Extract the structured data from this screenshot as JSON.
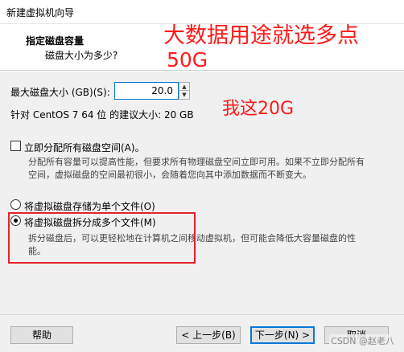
{
  "window": {
    "title": "新建虚拟机向导"
  },
  "header": {
    "title": "指定磁盘容量",
    "subtitle": "磁盘大小为多少?"
  },
  "annotations": {
    "line1": "大数据用途就选多点",
    "line2": "50G",
    "line3": "我这20G"
  },
  "disk": {
    "max_size_label": "最大磁盘大小 (GB)(S):",
    "max_size_value": "20.0",
    "recommend_text": "针对 CentOS 7 64 位 的建议大小: 20 GB"
  },
  "allocate": {
    "label": "立即分配所有磁盘空间(A)。",
    "checked": false,
    "desc_line1": "分配所有容量可以提高性能，但要求所有物理磁盘空间立即可用。如果不立即分配所有",
    "desc_line2": "空间，虚拟磁盘的空间最初很小，会随着您向其中添加数据而不断变大。"
  },
  "options": [
    {
      "label": "将虚拟磁盘存储为单个文件(O)",
      "selected": false
    },
    {
      "label": "将虚拟磁盘拆分成多个文件(M)",
      "selected": true,
      "desc_line1": "拆分磁盘后，可以更轻松地在计算机之间移动虚拟机，但可能会降低大容量磁盘的性",
      "desc_line2": "能。"
    }
  ],
  "footer": {
    "help": "帮助",
    "back": "< 上一步(B)",
    "next": "下一步(N) >",
    "cancel": "取消"
  },
  "watermark": "CSDN @赵老八"
}
